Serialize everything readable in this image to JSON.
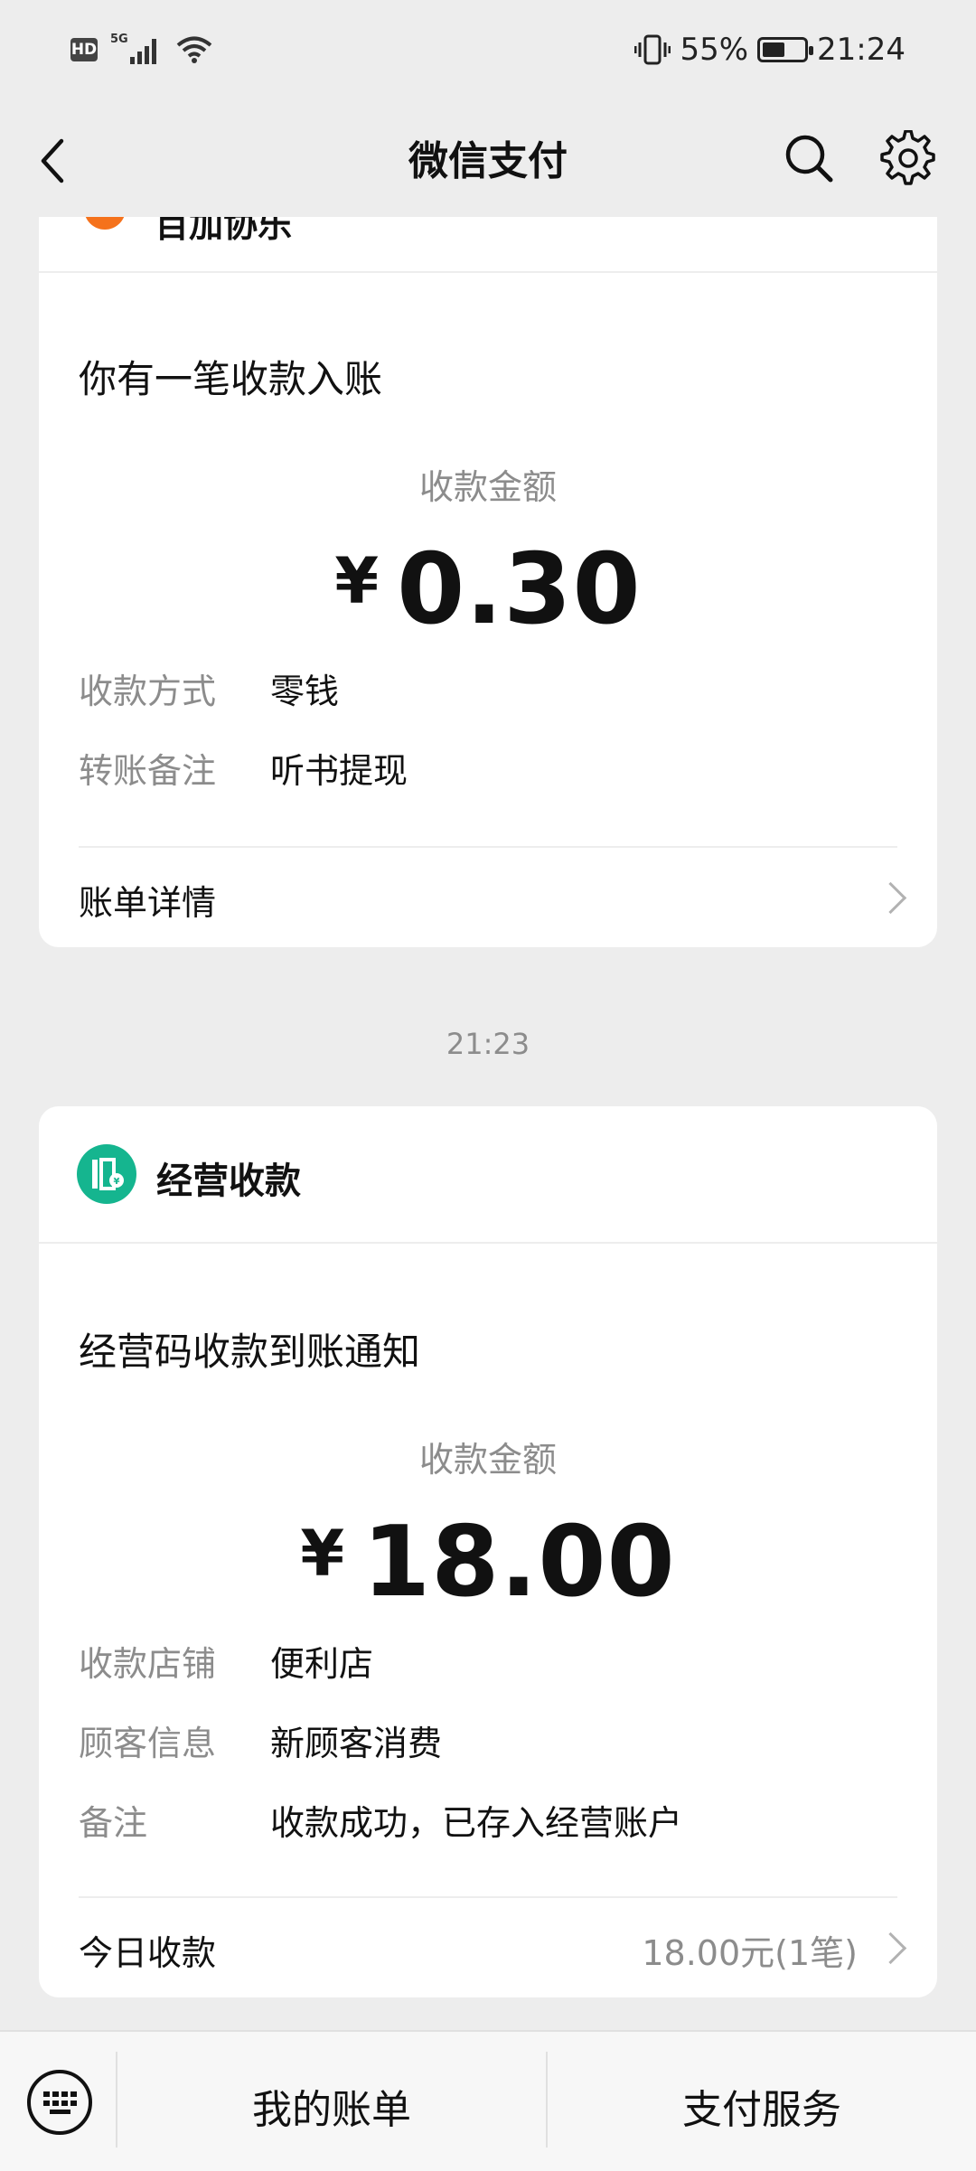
{
  "status_bar": {
    "hd": "HD",
    "network": "5G",
    "battery": "55%",
    "time": "21:24",
    "battery_level": 0.55
  },
  "header": {
    "title": "微信支付"
  },
  "card1": {
    "header_text": "百加协乐",
    "notice_title": "你有一笔收款入账",
    "amount_caption": "收款金额",
    "currency": "¥",
    "amount": "0.30",
    "rows": [
      {
        "label": "收款方式",
        "value": "零钱"
      },
      {
        "label": "转账备注",
        "value": "听书提现"
      }
    ],
    "footer_label": "账单详情"
  },
  "timestamp": "21:23",
  "card2": {
    "app_name": "经营收款",
    "notice_title": "经营码收款到账通知",
    "amount_caption": "收款金额",
    "currency": "¥",
    "amount": "18.00",
    "rows": [
      {
        "label": "收款店铺",
        "value": "便利店"
      },
      {
        "label": "顾客信息",
        "value": "新顾客消费"
      },
      {
        "label": "备注",
        "value": "收款成功，已存入经营账户"
      }
    ],
    "footer_label": "今日收款",
    "footer_value": "18.00元(1笔)",
    "icon_color": "#15b58f"
  },
  "bottom_bar": {
    "my_bills": "我的账单",
    "pay_services": "支付服务"
  },
  "colors": {
    "background": "#ededed",
    "card": "#ffffff",
    "secondary_text": "#8c8c8c",
    "accent_green": "#15b58f",
    "orange_icon": "#f5721c"
  }
}
